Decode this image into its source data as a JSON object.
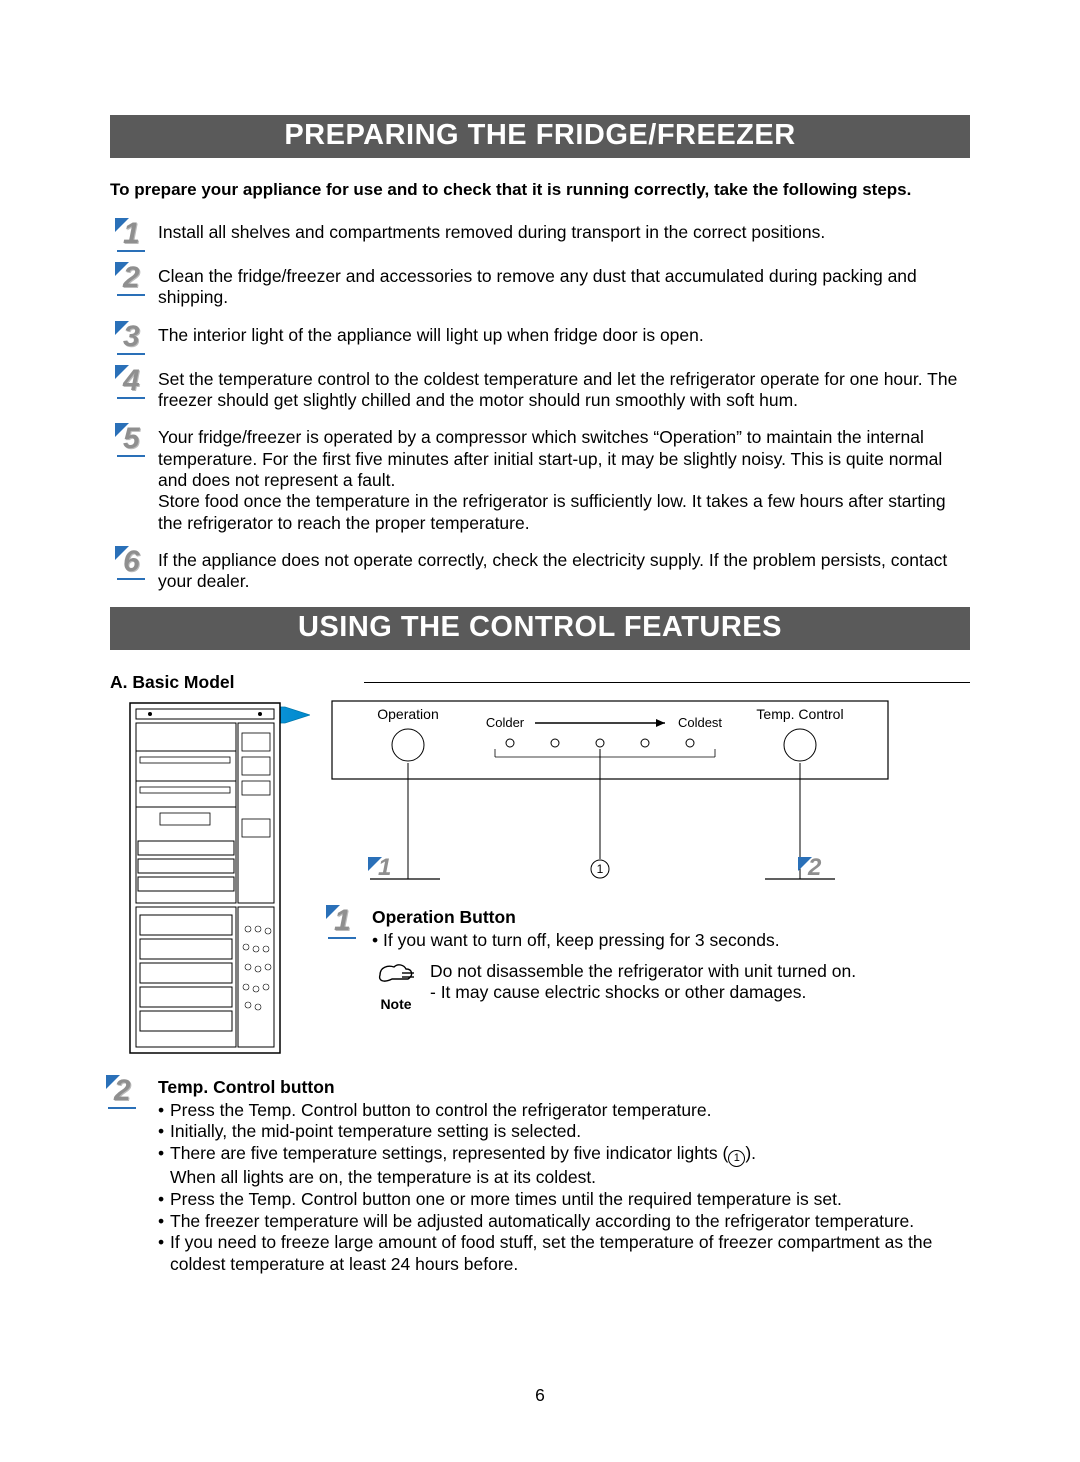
{
  "section1": {
    "title": "PREPARING THE FRIDGE/FREEZER",
    "intro": "To prepare your appliance for use and to check that it is running correctly, take the following steps.",
    "steps": [
      {
        "n": "1",
        "text": "Install all shelves and compartments removed during transport in the correct positions."
      },
      {
        "n": "2",
        "text": "Clean the fridge/freezer and accessories to remove any dust that accumulated during packing and shipping."
      },
      {
        "n": "3",
        "text": "The interior light of the appliance will light up when fridge door is open."
      },
      {
        "n": "4",
        "text": "Set the temperature control to the coldest temperature and let the refrigerator operate for one hour. The freezer should get slightly chilled and the motor should run smoothly with soft hum."
      },
      {
        "n": "5",
        "text": "Your fridge/freezer is operated by a compressor which switches “Operation” to maintain the internal temperature. For the first five minutes after initial start-up, it may be slightly noisy. This is quite normal and does not represent a fault.\nStore food once the temperature in the refrigerator is sufficiently low. It takes a few hours after starting the refrigerator to reach the proper temperature."
      },
      {
        "n": "6",
        "text": "If the appliance does not operate correctly, check the electricity supply. If the problem persists, contact your dealer."
      }
    ]
  },
  "section2": {
    "title": "USING THE CONTROL FEATURES",
    "subtitle": "A. Basic Model",
    "panel": {
      "operation_label": "Operation",
      "temp_label": "Temp. Control",
      "colder": "Colder",
      "coldest": "Coldest",
      "callout_left": "1",
      "callout_right": "2"
    },
    "op_button": {
      "n": "1",
      "heading": "Operation Button",
      "bullet": "If you want to turn off, keep pressing for 3 seconds.",
      "note_label": "Note",
      "note_lines": [
        "Do not disassemble the refrigerator with unit turned on.",
        "- It may cause electric shocks or other damages."
      ]
    },
    "temp_button": {
      "n": "2",
      "heading": "Temp. Control button",
      "bullets": [
        "Press the Temp. Control button to control the refrigerator temperature.",
        "Initially, the mid-point temperature setting is selected.",
        "There are five temperature settings, represented by five indicator lights (①).",
        "When all lights are on, the temperature is at its coldest.",
        "Press the Temp. Control button one or more times until the required temperature is set.",
        "The freezer temperature will be adjusted automatically according to the refrigerator temperature.",
        "If you need to freeze large amount of food stuff, set the temperature of freezer compartment as the coldest temperature at least 24 hours before."
      ]
    }
  },
  "page_number": "6"
}
